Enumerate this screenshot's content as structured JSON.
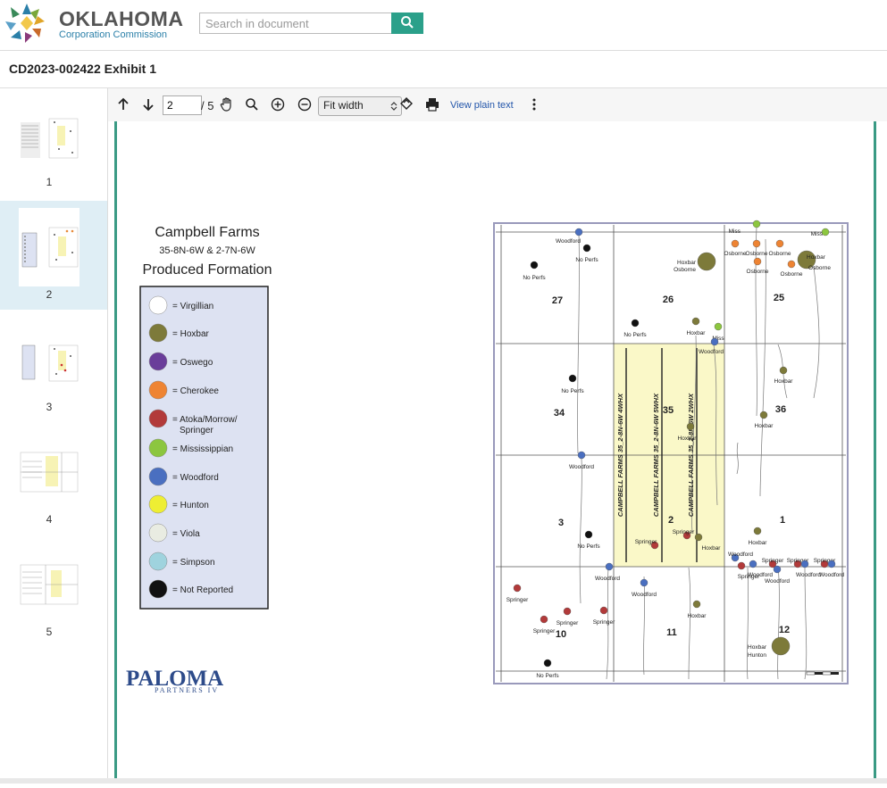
{
  "header": {
    "logo_title": "OKLAHOMA",
    "logo_subtitle": "Corporation Commission",
    "search_placeholder": "Search in document"
  },
  "document": {
    "title": "CD2023-002422 Exhibit 1"
  },
  "thumbnails": [
    {
      "label": "1",
      "selected": false
    },
    {
      "label": "2",
      "selected": true
    },
    {
      "label": "3",
      "selected": false
    },
    {
      "label": "4",
      "selected": false
    },
    {
      "label": "5",
      "selected": false
    }
  ],
  "toolbar": {
    "page_value": "2",
    "page_total": "/ 5",
    "zoom_value": "Fit width",
    "view_plain_text": "View plain text"
  },
  "legend": {
    "title": "Campbell Farms",
    "subtitle": "35-8N-6W & 2-7N-6W",
    "heading": "Produced Formation",
    "items": [
      {
        "label": "= Virgillian",
        "color": "#ffffff"
      },
      {
        "label": "= Hoxbar",
        "color": "#7d7a3a"
      },
      {
        "label": "= Oswego",
        "color": "#6a3d9a"
      },
      {
        "label": "= Cherokee",
        "color": "#ee8433"
      },
      {
        "label": "= Atoka/Morrow/",
        "label2": "Springer",
        "color": "#b23a3a"
      },
      {
        "label": "= Mississippian",
        "color": "#8cc63f"
      },
      {
        "label": "= Woodford",
        "color": "#4a6fc0"
      },
      {
        "label": "= Hunton",
        "color": "#eeee33"
      },
      {
        "label": "= Viola",
        "color": "#e9ece2"
      },
      {
        "label": "= Simpson",
        "color": "#9fd3de"
      },
      {
        "label": "= Not Reported",
        "color": "#111111"
      }
    ]
  },
  "company": {
    "name": "PALOMA",
    "sub": "PARTNERS IV"
  },
  "map": {
    "sections": [
      "27",
      "26",
      "25",
      "34",
      "35",
      "36",
      "3",
      "2",
      "1",
      "10",
      "11",
      "12"
    ],
    "laterals": [
      "CAMPBELL FARMS 35_2-8N-6W 4WHX",
      "CAMPBELL FARMS 35_2-8N-6W 5WHX",
      "CAMPBELL FARMS 35_2-8N-6W 2WHX"
    ],
    "wells": [
      {
        "label": "Woodford",
        "color": "#4a6fc0"
      },
      {
        "label": "No Perfs",
        "color": "#111111"
      },
      {
        "label": "No Perfs",
        "color": "#111111"
      },
      {
        "label": "Miss",
        "color": "#8cc63f"
      },
      {
        "label": "Miss",
        "color": "#8cc63f"
      },
      {
        "label": "Osborne",
        "color": "#ee8433"
      },
      {
        "label": "Osborne",
        "color": "#ee8433"
      },
      {
        "label": "Osborne",
        "color": "#ee8433"
      },
      {
        "label": "Hoxbar",
        "color": "#7d7a3a"
      },
      {
        "label": "Osborne",
        "color": "#ee8433"
      },
      {
        "label": "Hoxbar",
        "color": "#7d7a3a"
      },
      {
        "label": "Osborne",
        "color": "#ee8433"
      },
      {
        "label": "Osborne",
        "color": "#ee8433"
      },
      {
        "label": "Osborne",
        "color": "#ee8433"
      },
      {
        "label": "No Perfs",
        "color": "#111111"
      },
      {
        "label": "Hoxbar",
        "color": "#7d7a3a"
      },
      {
        "label": "Miss",
        "color": "#8cc63f"
      },
      {
        "label": "Woodford",
        "color": "#4a6fc0"
      },
      {
        "label": "No Perfs",
        "color": "#111111"
      },
      {
        "label": "Hoxbar",
        "color": "#7d7a3a"
      },
      {
        "label": "Hoxbar",
        "color": "#7d7a3a"
      },
      {
        "label": "Hoxbar",
        "color": "#7d7a3a"
      },
      {
        "label": "Woodford",
        "color": "#4a6fc0"
      },
      {
        "label": "No Perfs",
        "color": "#111111"
      },
      {
        "label": "Springer",
        "color": "#b23a3a"
      },
      {
        "label": "Springer",
        "color": "#b23a3a"
      },
      {
        "label": "Hoxbar",
        "color": "#7d7a3a"
      },
      {
        "label": "Hoxbar",
        "color": "#7d7a3a"
      },
      {
        "label": "Woodford",
        "color": "#4a6fc0"
      },
      {
        "label": "Woodford",
        "color": "#4a6fc0"
      },
      {
        "label": "Woodford",
        "color": "#4a6fc0"
      },
      {
        "label": "Springer",
        "color": "#b23a3a"
      },
      {
        "label": "Woodford",
        "color": "#4a6fc0"
      },
      {
        "label": "Springer",
        "color": "#b23a3a"
      },
      {
        "label": "Woodford",
        "color": "#4a6fc0"
      },
      {
        "label": "Springer",
        "color": "#b23a3a"
      },
      {
        "label": "Woodford",
        "color": "#4a6fc0"
      },
      {
        "label": "Springer",
        "color": "#b23a3a"
      },
      {
        "label": "Woodford",
        "color": "#4a6fc0"
      },
      {
        "label": "Springer",
        "color": "#b23a3a"
      },
      {
        "label": "Springer",
        "color": "#b23a3a"
      },
      {
        "label": "Springer",
        "color": "#b23a3a"
      },
      {
        "label": "Springer",
        "color": "#b23a3a"
      },
      {
        "label": "Hoxbar",
        "color": "#7d7a3a"
      },
      {
        "label": "No Perfs",
        "color": "#111111"
      },
      {
        "label": "Hoxbar",
        "color": "#7d7a3a"
      },
      {
        "label": "Hunton",
        "color": "#eeee33"
      }
    ]
  }
}
